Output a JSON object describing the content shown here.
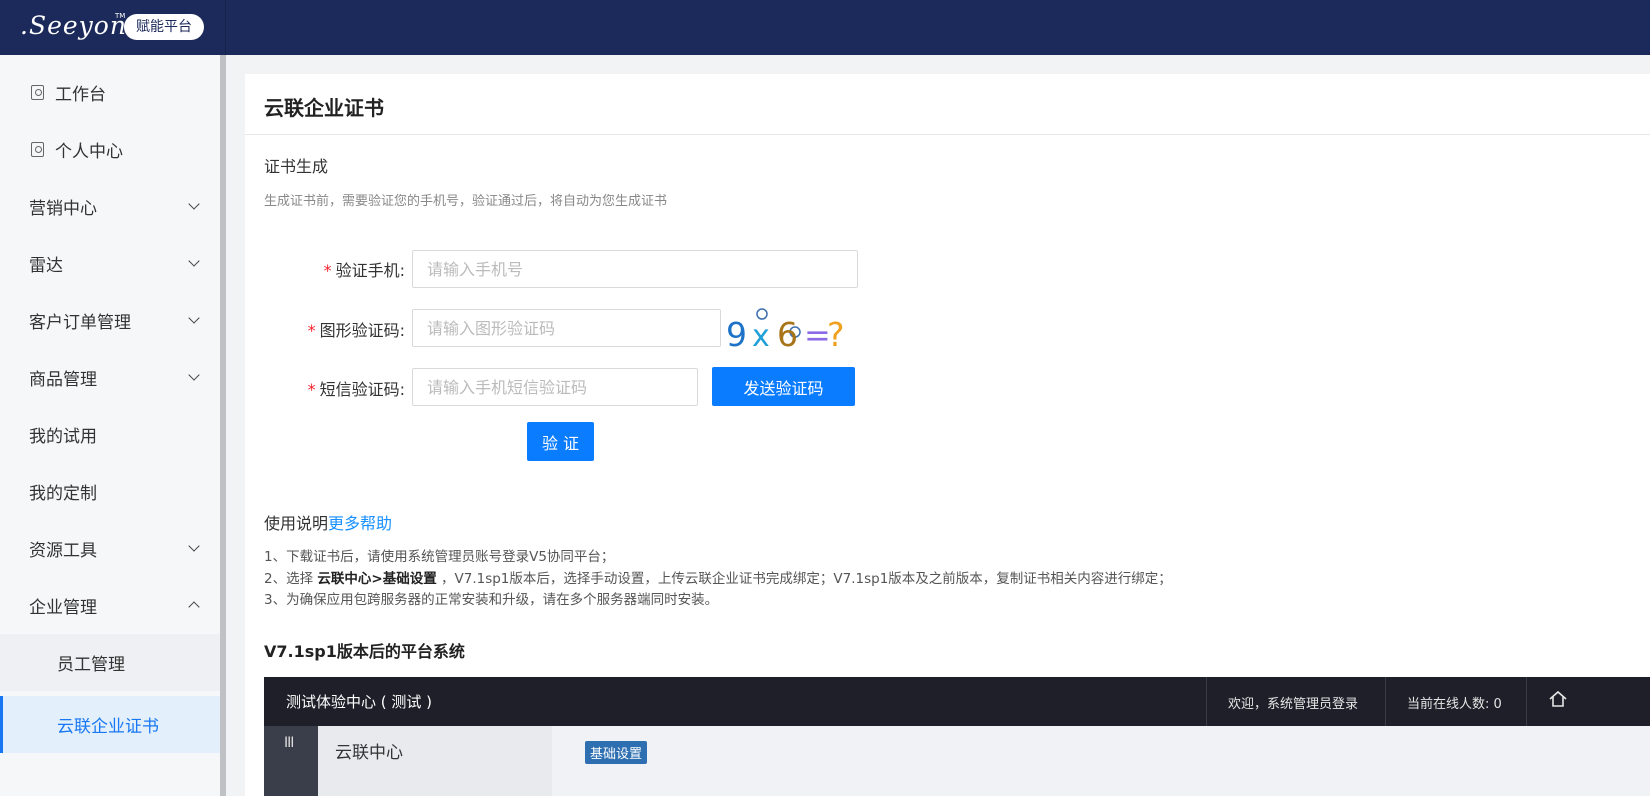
{
  "brand": {
    "logo_text": ".Seeyon",
    "logo_tm": "TM",
    "badge": "赋能平台"
  },
  "sidebar": {
    "items": [
      {
        "label": "工作台"
      },
      {
        "label": "个人中心"
      },
      {
        "label": "营销中心"
      },
      {
        "label": "雷达"
      },
      {
        "label": "客户订单管理"
      },
      {
        "label": "商品管理"
      },
      {
        "label": "我的试用"
      },
      {
        "label": "我的定制"
      },
      {
        "label": "资源工具"
      },
      {
        "label": "企业管理"
      },
      {
        "label": "员工管理"
      },
      {
        "label": "云联企业证书"
      }
    ]
  },
  "page": {
    "title": "云联企业证书",
    "section_title": "证书生成",
    "section_desc": "生成证书前，需要验证您的手机号，验证通过后，将自动为您生成证书"
  },
  "form": {
    "required_mark": "*",
    "phone_label": "验证手机:",
    "phone_placeholder": "请输入手机号",
    "captcha_label": "图形验证码:",
    "captcha_placeholder": "请输入图形验证码",
    "captcha_text": {
      "a": "9",
      "op": "x",
      "b": "6",
      "eq": "=",
      "q": "?"
    },
    "sms_label": "短信验证码:",
    "sms_placeholder": "请输入手机短信验证码",
    "send_code_button": "发送验证码",
    "verify_button": "验 证"
  },
  "usage": {
    "title": "使用说明",
    "help_link": "更多帮助",
    "line1": "1、下载证书后，请使用系统管理员账号登录V5协同平台；",
    "line2_prefix": "2、选择 ",
    "line2_bold": "云联中心>基础设置",
    "line2_suffix": " ，V7.1sp1版本后，选择手动设置，上传云联企业证书完成绑定；V7.1sp1版本及之前版本，复制证书相关内容进行绑定；",
    "line3": "3、为确保应用包跨服务器的正常安装和升级，请在多个服务器端同时安装。"
  },
  "platform": {
    "heading": "V7.1sp1版本后的平台系统",
    "shot_title": "测试体验中心 ( 测试 )",
    "welcome": "欢迎，系统管理员登录",
    "online": "当前在线人数: 0",
    "menu_icon": "III",
    "nav_label": "云联中心",
    "tag": "基础设置"
  },
  "colors": {
    "topbar": "#1b2a5a",
    "primary": "#0a7cff",
    "link": "#1890ff",
    "required": "#f5222d",
    "active_bg": "#e3f0fc"
  }
}
